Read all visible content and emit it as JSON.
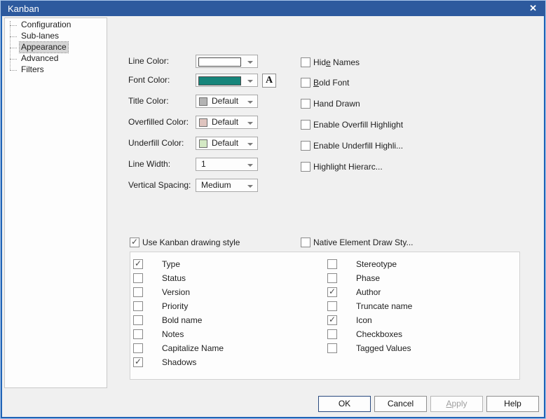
{
  "window": {
    "title": "Kanban",
    "close_icon": "✕"
  },
  "colors": {
    "titlebar_blue": "#2d5a9e",
    "border_blue": "#1f63b6",
    "font_color_teal": "#17857B"
  },
  "tree": {
    "items": [
      {
        "label": "Configuration",
        "selected": false
      },
      {
        "label": "Sub-lanes",
        "selected": false
      },
      {
        "label": "Appearance",
        "selected": true
      },
      {
        "label": "Advanced",
        "selected": false
      },
      {
        "label": "Filters",
        "selected": false
      }
    ]
  },
  "form": {
    "rows": [
      {
        "label": "Line Color:",
        "type": "swatch-wide",
        "swatch": "#ffffff"
      },
      {
        "label": "Font Color:",
        "type": "swatch-wide",
        "swatch": "#17857B"
      },
      {
        "label": "Title Color:",
        "type": "swatch-default",
        "swatch": "#b3b3b3",
        "value": "Default"
      },
      {
        "label": "Overfilled Color:",
        "type": "swatch-default",
        "swatch": "#dfc4bf",
        "value": "Default"
      },
      {
        "label": "Underfill Color:",
        "type": "swatch-default",
        "swatch": "#d4e9c4",
        "value": "Default"
      },
      {
        "label": "Line Width:",
        "type": "text",
        "value": "1"
      },
      {
        "label": "Vertical Spacing:",
        "type": "text",
        "value": "Medium"
      }
    ],
    "font_button_label": "A"
  },
  "options": {
    "items": [
      {
        "text": "Hide Names",
        "u": 3,
        "checked": false
      },
      {
        "text": "Bold Font",
        "u": 0,
        "checked": false
      },
      {
        "text": "Hand Drawn",
        "checked": false
      },
      {
        "text": "Enable Overfill Highlight",
        "checked": false
      },
      {
        "text": "Enable Underfill Highli...",
        "checked": false
      },
      {
        "text": "Highlight Hierarc...",
        "checked": false
      }
    ]
  },
  "style_toggles": {
    "use_kanban": {
      "text": "Use Kanban drawing style",
      "checked": true
    },
    "native_draw": {
      "text": "Native Element Draw Sty...",
      "checked": false
    }
  },
  "display_group": {
    "left": [
      {
        "text": "Type",
        "checked": true
      },
      {
        "text": "Status",
        "checked": false
      },
      {
        "text": "Version",
        "checked": false
      },
      {
        "text": "Priority",
        "checked": false
      },
      {
        "text": "Bold name",
        "checked": false
      },
      {
        "text": "Notes",
        "checked": false
      },
      {
        "text": "Capitalize Name",
        "checked": false
      },
      {
        "text": "Shadows",
        "checked": true
      }
    ],
    "right": [
      {
        "text": "Stereotype",
        "checked": false
      },
      {
        "text": "Phase",
        "checked": false
      },
      {
        "text": "Author",
        "checked": true
      },
      {
        "text": "Truncate name",
        "checked": false
      },
      {
        "text": "Icon",
        "checked": true
      },
      {
        "text": "Checkboxes",
        "checked": false
      },
      {
        "text": "Tagged Values",
        "checked": false
      }
    ]
  },
  "buttons": [
    {
      "text": "OK",
      "default": true
    },
    {
      "text": "Cancel"
    },
    {
      "text": "Apply",
      "u": 0,
      "disabled": true
    },
    {
      "text": "Help"
    }
  ]
}
